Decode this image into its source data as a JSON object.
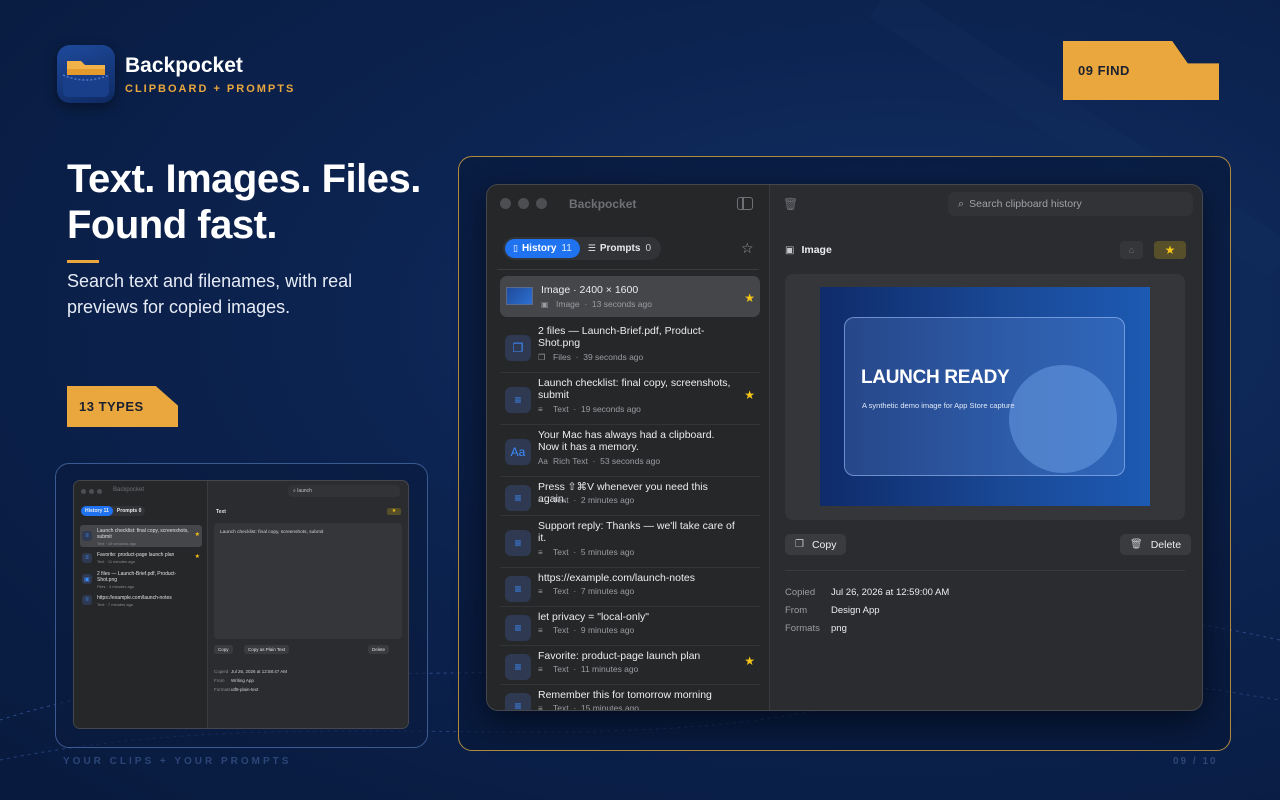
{
  "brand": {
    "name": "Backpocket",
    "tagline": "CLIPBOARD + PROMPTS"
  },
  "tags": {
    "find": "09 FIND",
    "types": "13 TYPES"
  },
  "headline": {
    "line1": "Text. Images. Files.",
    "line2": "Found fast."
  },
  "subhead": "Search text and filenames, with real previews for copied images.",
  "footer": {
    "left": "YOUR CLIPS + YOUR PROMPTS",
    "right": "09 / 10"
  },
  "colors": {
    "accent": "#e9a73d",
    "blue": "#1f73f1",
    "star": "#f5c518",
    "background": "#0c2350"
  },
  "window": {
    "title": "Backpocket",
    "tabs": [
      {
        "label": "History",
        "count": "11",
        "active": true
      },
      {
        "label": "Prompts",
        "count": "0",
        "active": false
      }
    ],
    "search_placeholder": "Search clipboard history",
    "items": [
      {
        "title": "Image · 2400 × 1600",
        "type": "Image",
        "time": "13 seconds ago",
        "starred": true,
        "icon": "image-icon",
        "selected": true
      },
      {
        "title": "2 files — Launch-Brief.pdf, Product-Shot.png",
        "type": "Files",
        "time": "39 seconds ago",
        "starred": false,
        "icon": "files-icon"
      },
      {
        "title": "Launch checklist: final copy, screenshots, submit",
        "type": "Text",
        "time": "19 seconds ago",
        "starred": true,
        "icon": "text-icon"
      },
      {
        "title": "Your Mac has always had a clipboard. Now it has a memory.",
        "type": "Rich Text",
        "time": "53 seconds ago",
        "starred": false,
        "icon": "rich-text-icon"
      },
      {
        "title": "Press ⇧⌘V whenever you need this again.",
        "type": "Text",
        "time": "2 minutes ago",
        "starred": false,
        "icon": "text-icon"
      },
      {
        "title": "Support reply: Thanks — we'll take care of it.",
        "type": "Text",
        "time": "5 minutes ago",
        "starred": false,
        "icon": "text-icon"
      },
      {
        "title": "https://example.com/launch-notes",
        "type": "Text",
        "time": "7 minutes ago",
        "starred": false,
        "icon": "text-icon"
      },
      {
        "title": "let privacy = \"local-only\"",
        "type": "Text",
        "time": "9 minutes ago",
        "starred": false,
        "icon": "text-icon"
      },
      {
        "title": "Favorite: product-page launch plan",
        "type": "Text",
        "time": "11 minutes ago",
        "starred": true,
        "icon": "text-icon"
      },
      {
        "title": "Remember this for tomorrow morning",
        "type": "Text",
        "time": "15 minutes ago",
        "starred": false,
        "icon": "text-icon"
      }
    ],
    "detail": {
      "type_label": "Image",
      "preview_title": "LAUNCH READY",
      "preview_subtitle": "A synthetic demo image for App Store capture",
      "copy_label": "Copy",
      "delete_label": "Delete",
      "meta": [
        {
          "label": "Copied",
          "value": "Jul 26, 2026 at 12:59:00 AM"
        },
        {
          "label": "From",
          "value": "Design App"
        },
        {
          "label": "Formats",
          "value": "png"
        }
      ]
    }
  },
  "mini_window": {
    "title": "Backpocket",
    "tabs": [
      {
        "label": "History",
        "count": "11"
      },
      {
        "label": "Prompts",
        "count": "0"
      }
    ],
    "search_query": "launch",
    "items": [
      {
        "title": "Launch checklist: final copy, screenshots, submit",
        "type": "Text",
        "time": "19 seconds ago",
        "starred": true
      },
      {
        "title": "Favorite: product-page launch plan",
        "type": "Text",
        "time": "11 minutes ago",
        "starred": true
      },
      {
        "title": "2 files — Launch-Brief.pdf, Product-Shot.png",
        "type": "Files",
        "time": "4 minutes ago",
        "starred": false
      },
      {
        "title": "https://example.com/launch-notes",
        "type": "Text",
        "time": "7 minutes ago",
        "starred": false
      }
    ],
    "detail": {
      "type_label": "Text",
      "text": "Launch checklist: final copy, screenshots, submit",
      "copy_label": "Copy",
      "copy_plain_label": "Copy as Plain Text",
      "delete_label": "Delete",
      "meta": [
        {
          "label": "Copied",
          "value": "Jul 26, 2026 at 12:58:47 AM"
        },
        {
          "label": "From",
          "value": "Writing App"
        },
        {
          "label": "Formats",
          "value": "utf8-plain-text"
        }
      ]
    }
  }
}
